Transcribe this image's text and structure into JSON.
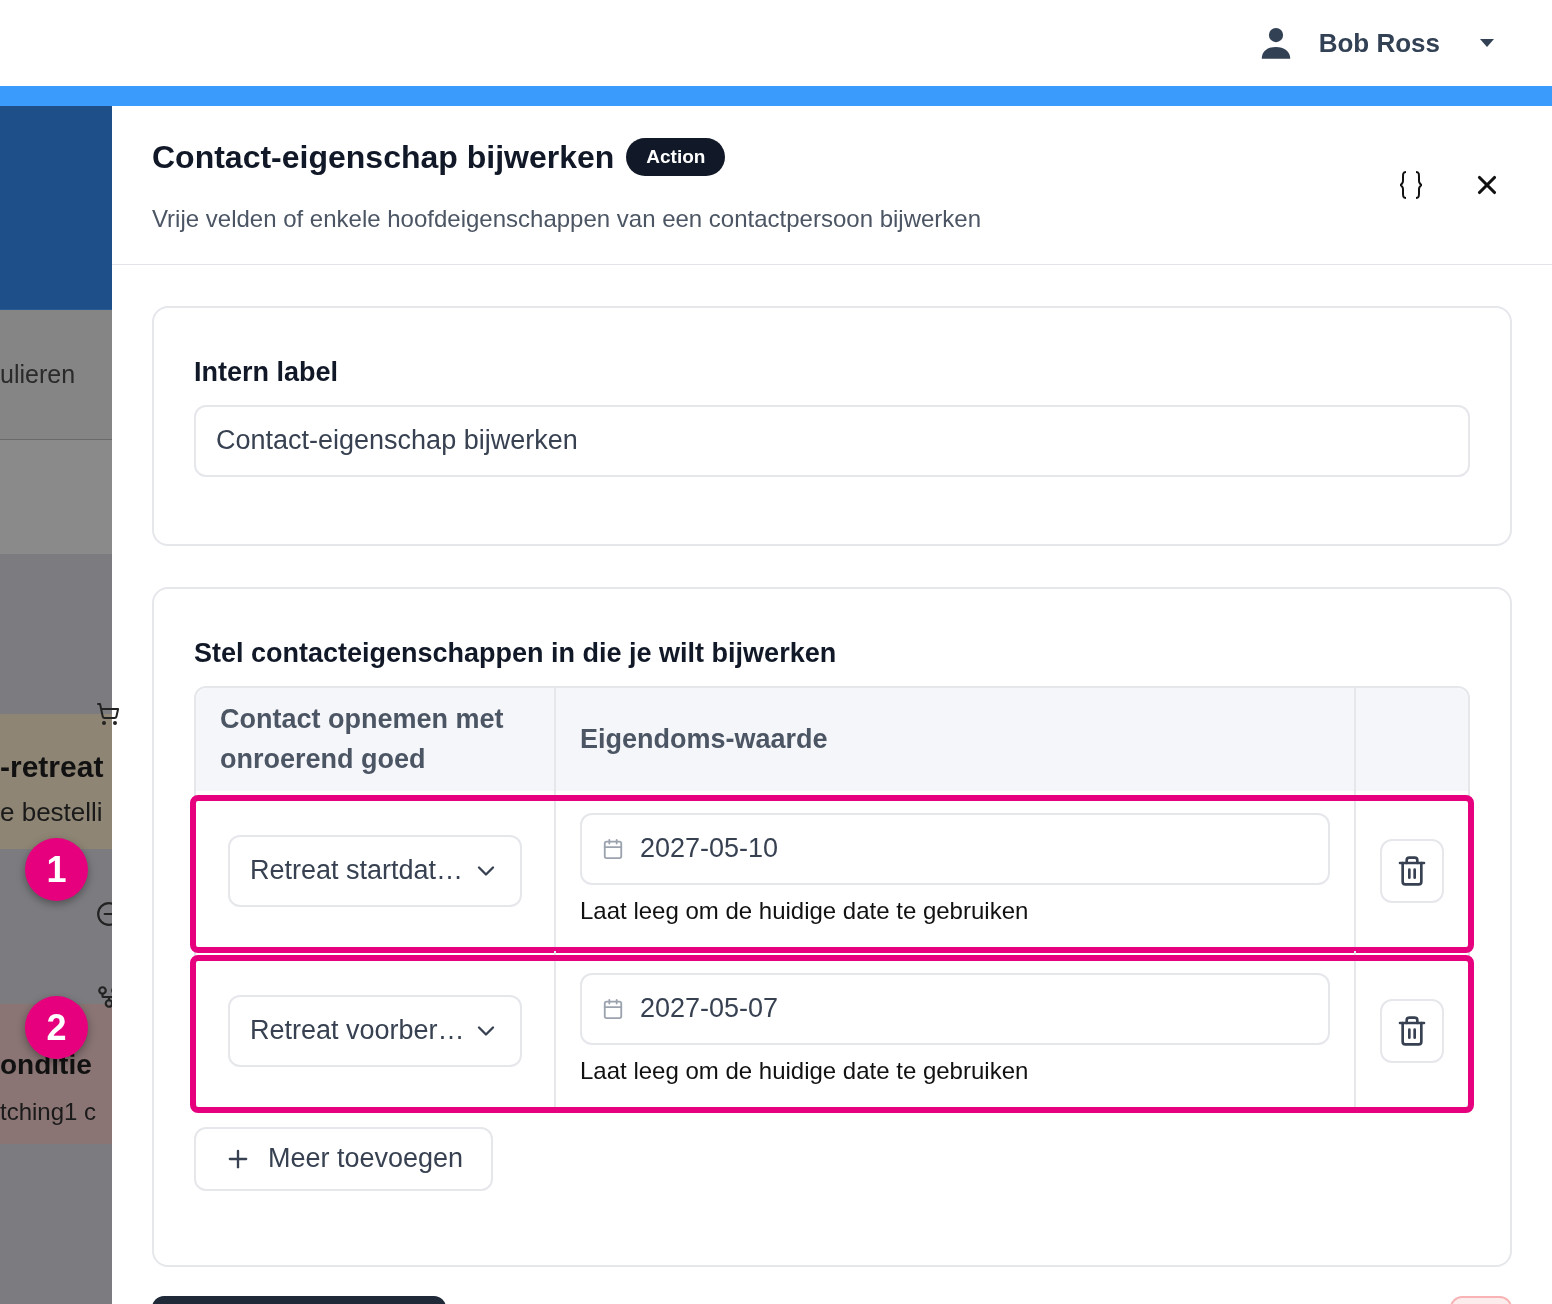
{
  "user": {
    "name": "Bob Ross"
  },
  "background": {
    "texts": [
      "ulieren",
      "-retreat",
      "e bestelli",
      "onditie",
      "tching1 c"
    ]
  },
  "panel": {
    "title": "Contact-eigenschap bijwerken",
    "badge": "Action",
    "subtitle": "Vrije velden of enkele hoofdeigenschappen van een contactpersoon bijwerken"
  },
  "label_card": {
    "label": "Intern label",
    "value": "Contact-eigenschap bijwerken"
  },
  "properties": {
    "heading": "Stel contacteigenschappen in die je wilt bijwerken",
    "columns": [
      "Contact opnemen met onroerend goed",
      "Eigendoms-waarde"
    ],
    "rows": [
      {
        "property": "Retreat startdat…",
        "value": "2027-05-10",
        "hint": "Laat leeg om de huidige date te gebruiken",
        "marker": "1",
        "highlighted": true
      },
      {
        "property": "Retreat voorber…",
        "value": "2027-05-07",
        "hint": "Laat leeg om de huidige date te gebruiken",
        "marker": "2",
        "highlighted": true
      }
    ]
  },
  "add_button": "Meer toevoegen"
}
